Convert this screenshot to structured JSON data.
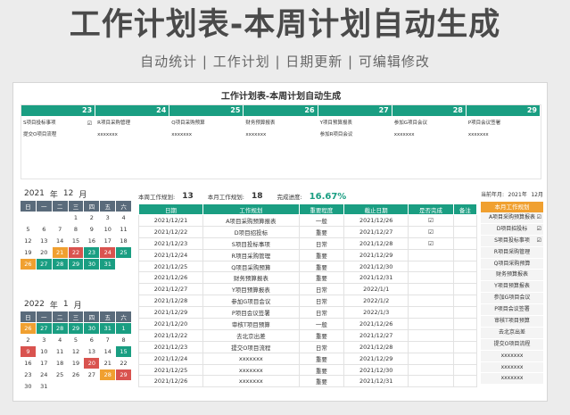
{
  "hero": {
    "title": "工作计划表-本周计划自动生成",
    "subtitle": "自动统计 | 工作计划 | 日期更新 | 可编辑修改"
  },
  "sheet": {
    "title": "工作计划表-本周计划自动生成"
  },
  "week": {
    "days": [
      "23",
      "24",
      "25",
      "26",
      "27",
      "28",
      "29"
    ],
    "cols": [
      [
        {
          "t": "S项目投标事项",
          "c": "☑"
        },
        {
          "t": "提交O项目流程",
          "c": ""
        }
      ],
      [
        {
          "t": "R项目采购管理",
          "c": ""
        },
        {
          "t": "xxxxxxx",
          "c": ""
        }
      ],
      [
        {
          "t": "Q项目采购预算",
          "c": ""
        },
        {
          "t": "xxxxxxx",
          "c": ""
        }
      ],
      [
        {
          "t": "财务预算报表",
          "c": ""
        },
        {
          "t": "xxxxxxx",
          "c": ""
        }
      ],
      [
        {
          "t": "Y项目预算报表",
          "c": ""
        },
        {
          "t": "参加R项目会议",
          "c": ""
        }
      ],
      [
        {
          "t": "参加G项目会议",
          "c": ""
        },
        {
          "t": "xxxxxxx",
          "c": ""
        }
      ],
      [
        {
          "t": "P项目会议签署",
          "c": ""
        },
        {
          "t": "xxxxxxx",
          "c": ""
        }
      ]
    ]
  },
  "cal1": {
    "year": "2021",
    "yl": "年",
    "month": "12",
    "ml": "月",
    "top": "208"
  },
  "cal2": {
    "year": "2022",
    "yl": "年",
    "month": "1",
    "ml": "月",
    "top": "332"
  },
  "weekdays": [
    "日",
    "一",
    "二",
    "三",
    "四",
    "五",
    "六"
  ],
  "cal1_days": [
    [
      "",
      "",
      ""
    ],
    [
      "",
      "",
      ""
    ],
    [
      "",
      "",
      ""
    ],
    [
      "1",
      ""
    ],
    [
      "2",
      ""
    ],
    [
      "3",
      ""
    ],
    [
      "4",
      ""
    ],
    [
      "5",
      ""
    ],
    [
      "6",
      ""
    ],
    [
      "7",
      ""
    ],
    [
      "8",
      ""
    ],
    [
      "9",
      ""
    ],
    [
      "10",
      ""
    ],
    [
      "11",
      ""
    ],
    [
      "12",
      ""
    ],
    [
      "13",
      ""
    ],
    [
      "14",
      ""
    ],
    [
      "15",
      ""
    ],
    [
      "16",
      ""
    ],
    [
      "17",
      ""
    ],
    [
      "18",
      ""
    ],
    [
      "19",
      ""
    ],
    [
      "20",
      ""
    ],
    [
      "21",
      "c-or"
    ],
    [
      "22",
      "c-rd"
    ],
    [
      "23",
      "c-gr"
    ],
    [
      "24",
      "c-rd"
    ],
    [
      "25",
      "c-gr"
    ],
    [
      "26",
      "c-or"
    ],
    [
      "27",
      "c-gr"
    ],
    [
      "28",
      "c-gr"
    ],
    [
      "29",
      "c-gr"
    ],
    [
      "30",
      "c-gr"
    ],
    [
      "31",
      "c-gr"
    ],
    [
      "",
      ""
    ]
  ],
  "cal2_days": [
    [
      "26",
      "c-or"
    ],
    [
      "27",
      "c-gr"
    ],
    [
      "28",
      "c-gr"
    ],
    [
      "29",
      "c-gr"
    ],
    [
      "30",
      "c-gr"
    ],
    [
      "31",
      "c-gr"
    ],
    [
      "1",
      "c-gr"
    ],
    [
      "2",
      ""
    ],
    [
      "3",
      ""
    ],
    [
      "4",
      ""
    ],
    [
      "5",
      ""
    ],
    [
      "6",
      ""
    ],
    [
      "7",
      ""
    ],
    [
      "8",
      ""
    ],
    [
      "9",
      "c-rd"
    ],
    [
      "10",
      ""
    ],
    [
      "11",
      ""
    ],
    [
      "12",
      ""
    ],
    [
      "13",
      ""
    ],
    [
      "14",
      ""
    ],
    [
      "15",
      "c-gr"
    ],
    [
      "16",
      ""
    ],
    [
      "17",
      ""
    ],
    [
      "18",
      ""
    ],
    [
      "19",
      ""
    ],
    [
      "20",
      "c-rd"
    ],
    [
      "21",
      ""
    ],
    [
      "22",
      ""
    ],
    [
      "23",
      ""
    ],
    [
      "24",
      ""
    ],
    [
      "25",
      ""
    ],
    [
      "26",
      ""
    ],
    [
      "27",
      ""
    ],
    [
      "28",
      "c-or"
    ],
    [
      "29",
      "c-rd"
    ],
    [
      "30",
      ""
    ],
    [
      "31",
      ""
    ],
    [
      "",
      ""
    ],
    [
      "",
      ""
    ],
    [
      "",
      ""
    ],
    [
      "",
      ""
    ],
    [
      "",
      ""
    ]
  ],
  "stats": {
    "week_label": "本周工作规划:",
    "week_val": "13",
    "month_label": "本月工作规划:",
    "month_val": "18",
    "prog_label": "完成进度:",
    "prog_val": "16.67%"
  },
  "table": {
    "headers": [
      "日期",
      "工作规划",
      "重要程度",
      "截止日期",
      "是否完成",
      "备注"
    ],
    "rows": [
      [
        "2021/12/21",
        "A项目采购预算报表",
        "一般",
        "2021/12/26",
        "☑",
        ""
      ],
      [
        "2021/12/22",
        "D项目招投标",
        "重要",
        "2021/12/27",
        "☑",
        ""
      ],
      [
        "2021/12/23",
        "S项目投标事项",
        "日常",
        "2021/12/28",
        "☑",
        ""
      ],
      [
        "2021/12/24",
        "R项目采购管理",
        "重要",
        "2021/12/29",
        "",
        ""
      ],
      [
        "2021/12/25",
        "Q项目采购预算",
        "重要",
        "2021/12/30",
        "",
        ""
      ],
      [
        "2021/12/26",
        "财务预算报表",
        "重要",
        "2021/12/31",
        "",
        ""
      ],
      [
        "2021/12/27",
        "Y项目预算报表",
        "日常",
        "2022/1/1",
        "",
        ""
      ],
      [
        "2021/12/28",
        "参加G项目会议",
        "日常",
        "2022/1/2",
        "",
        ""
      ],
      [
        "2021/12/29",
        "P项目会议签署",
        "日常",
        "2022/1/3",
        "",
        ""
      ],
      [
        "2021/12/20",
        "审核T项目预算",
        "一般",
        "2021/12/26",
        "",
        ""
      ],
      [
        "2021/12/22",
        "去北京出差",
        "重要",
        "2021/12/27",
        "",
        ""
      ],
      [
        "2021/12/23",
        "提交O项目流程",
        "日常",
        "2021/12/28",
        "",
        ""
      ],
      [
        "2021/12/24",
        "xxxxxxx",
        "重要",
        "2021/12/29",
        "",
        ""
      ],
      [
        "2021/12/25",
        "xxxxxxx",
        "重要",
        "2021/12/30",
        "",
        ""
      ],
      [
        "2021/12/26",
        "xxxxxxx",
        "重要",
        "2021/12/31",
        "",
        ""
      ]
    ]
  },
  "right": {
    "label": "当前年月:",
    "year": "2021年",
    "month": "12月",
    "header": "本月工作规划",
    "items": [
      [
        "A项目采购预算报表",
        "☑"
      ],
      [
        "D项目招投标",
        "☑"
      ],
      [
        "S项目投标事项",
        "☑"
      ],
      [
        "R项目采购管理",
        ""
      ],
      [
        "Q项目采购预算",
        ""
      ],
      [
        "财务预算报表",
        ""
      ],
      [
        "Y项目预算报表",
        ""
      ],
      [
        "参加G项目会议",
        ""
      ],
      [
        "P项目会议签署",
        ""
      ],
      [
        "审核T项目预算",
        ""
      ],
      [
        "去北京出差",
        ""
      ],
      [
        "提交O项目流程",
        ""
      ],
      [
        "xxxxxxx",
        ""
      ],
      [
        "xxxxxxx",
        ""
      ],
      [
        "xxxxxxx",
        ""
      ]
    ]
  }
}
